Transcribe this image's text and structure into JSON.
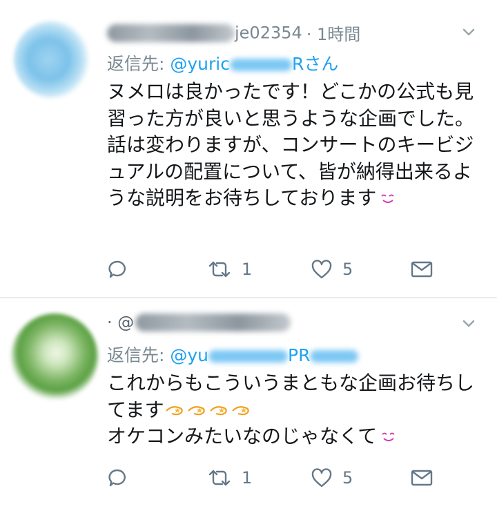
{
  "tweets": [
    {
      "handle_suffix": "je02354",
      "time": "· 1時間",
      "reply_label": "返信先: ",
      "reply_handle_start": "@yuric",
      "reply_handle_end": "Rさん",
      "text": [
        "ヌメロは良かったです！どこかの公式も見習った方が良いと思うような企画でした。",
        "話は変わりますが、コンサートのキービジュアルの配置について、皆が納得出来るような説明をお待ちしております"
      ],
      "retweets": "1",
      "likes": "5"
    },
    {
      "handle_prefix": "· @",
      "reply_label": "返信先: ",
      "reply_handle_start": "@yu",
      "reply_handle_end": "PR",
      "text": [
        "これからもこういうまともな企画お待ちしてます",
        "オケコンみたいなのじゃなくて"
      ],
      "retweets": "1",
      "likes": "5"
    }
  ],
  "colors": {
    "link": "#1da1f2",
    "meta": "#7a8891",
    "text": "#14171a",
    "emoji_pink": "#d63ab0",
    "emoji_orange": "#f0a020"
  },
  "icons": [
    "chevron-down-icon",
    "reply-icon",
    "retweet-icon",
    "like-icon",
    "dm-icon",
    "smile-emoji",
    "dizzy-emoji"
  ]
}
